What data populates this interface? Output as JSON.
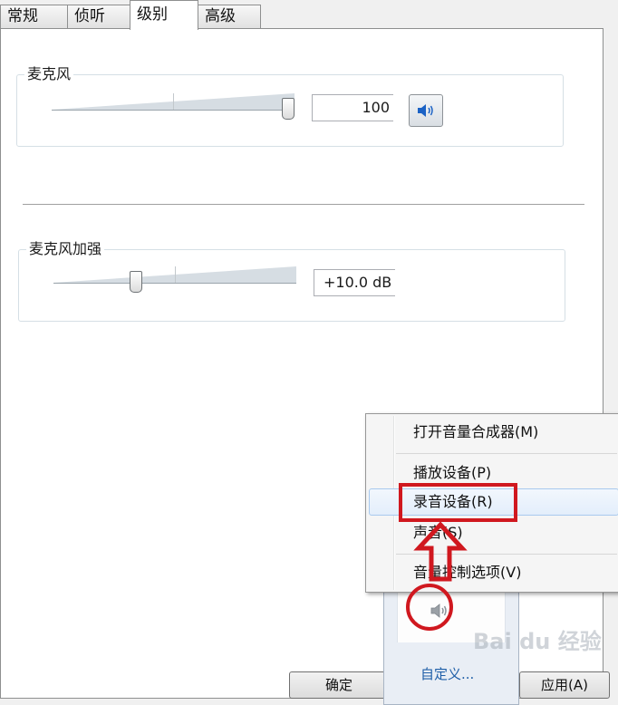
{
  "tabs": [
    {
      "label": "常规",
      "active": false
    },
    {
      "label": "侦听",
      "active": false
    },
    {
      "label": "级别",
      "active": true
    },
    {
      "label": "高级",
      "active": false
    }
  ],
  "microphone": {
    "title": "麦克风",
    "value": "100",
    "level": 1.0
  },
  "boost": {
    "title": "麦克风加强",
    "value": "+10.0 dB",
    "level": 0.33
  },
  "buttons": {
    "ok": "确定",
    "apply": "应用(A)"
  },
  "tray": {
    "customize": "自定义..."
  },
  "context_menu": {
    "items": [
      {
        "label": "打开音量合成器(M)"
      },
      {
        "label": "播放设备(P)"
      },
      {
        "label": "录音设备(R)"
      },
      {
        "label": "声音(S)"
      },
      {
        "label": "音量控制选项(V)"
      }
    ]
  },
  "watermark": "Bai du 经验",
  "colors": {
    "annotation_red": "#d0181f",
    "speaker_blue": "#1b62c5"
  }
}
